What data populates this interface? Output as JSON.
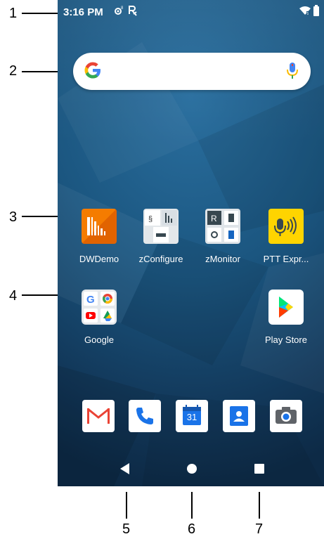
{
  "callouts": [
    "1",
    "2",
    "3",
    "4",
    "5",
    "6",
    "7"
  ],
  "status_bar": {
    "time": "3:16 PM",
    "icons": [
      "nfc-icon",
      "rx-icon",
      "wifi-icon",
      "battery-icon"
    ]
  },
  "search_bar": {
    "icons": [
      "google-g-icon",
      "microphone-icon"
    ]
  },
  "apps": [
    {
      "label": "DWDemo",
      "icon": "dwdemo-icon"
    },
    {
      "label": "zConfigure",
      "icon": "zconfigure-icon"
    },
    {
      "label": "zMonitor",
      "icon": "zmonitor-icon"
    },
    {
      "label": "PTT Expr...",
      "icon": "ptt-express-icon"
    },
    {
      "label": "Google",
      "icon": "google-folder-icon"
    },
    {
      "label": "Play Store",
      "icon": "play-store-icon"
    }
  ],
  "dock": [
    "gmail-icon",
    "phone-icon",
    "calendar-icon",
    "contacts-icon",
    "camera-icon"
  ],
  "calendar_day": "31",
  "navigation": [
    "back-button",
    "home-button",
    "recents-button"
  ],
  "colors": {
    "wallpaper": "#1b5680",
    "dwdemo": "#f57c00",
    "ptt": "#ffd400"
  }
}
